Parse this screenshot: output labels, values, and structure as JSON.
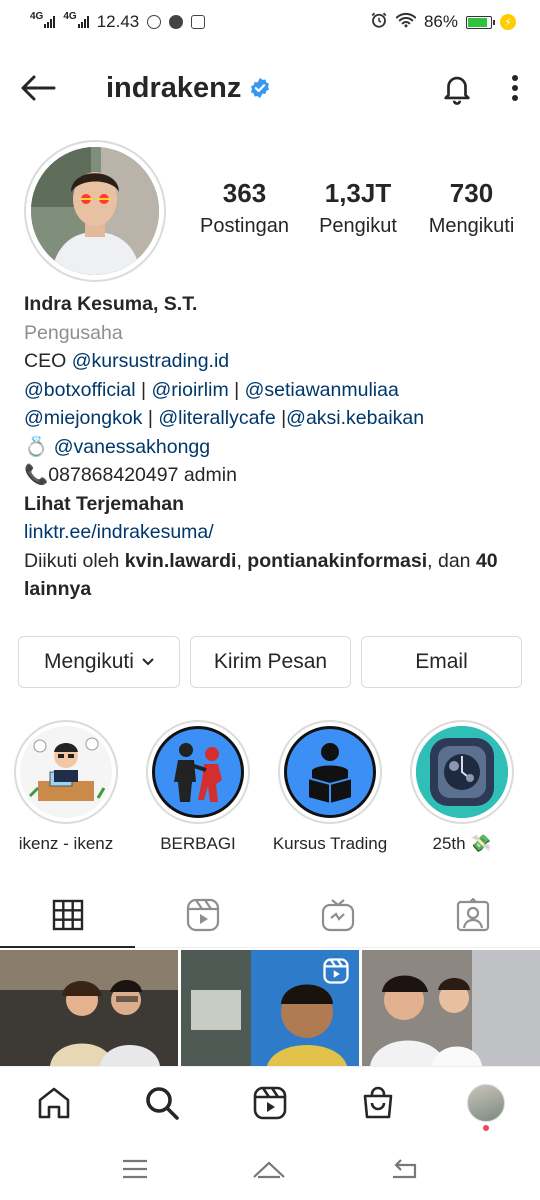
{
  "status_bar": {
    "net1": "4G",
    "net2": "4G",
    "time": "12.43",
    "battery": "86%",
    "battery_level": 0.86
  },
  "header": {
    "username": "indrakenz",
    "icons": [
      "arrow-left-icon",
      "verified-badge-icon",
      "bell-icon",
      "more-vertical-icon"
    ]
  },
  "stats": [
    {
      "num": "363",
      "label": "Postingan"
    },
    {
      "num": "1,3JT",
      "label": "Pengikut"
    },
    {
      "num": "730",
      "label": "Mengikuti"
    }
  ],
  "bio": {
    "name": "Indra Kesuma, S.T.",
    "category": "Pengusaha",
    "line1_prefix": "CEO ",
    "line1_link": "@kursustrading.id",
    "line2": [
      "@botxofficial",
      " | ",
      "@rioirlim",
      " | ",
      "@setiawanmuliaa"
    ],
    "line3": [
      "@miejongkok",
      " | ",
      "@literallycafe",
      " |",
      "@aksi.kebaikan"
    ],
    "ring_emoji": "💍",
    "line4_link": "@vanessakhongg",
    "phone_emoji": "📞",
    "phone": "087868420497 admin",
    "translate": "Lihat Terjemahan",
    "website": "linktr.ee/indrakesuma/",
    "followed_prefix": "Diikuti oleh ",
    "followed_user1": "kvin.lawardi",
    "followed_sep": ", ",
    "followed_user2": "pontianakinformasi",
    "followed_and": ", dan ",
    "followed_rest": "40 lainnya"
  },
  "buttons": {
    "following": "Mengikuti",
    "message": "Kirim Pesan",
    "email": "Email"
  },
  "highlights": [
    {
      "label": "ikenz - ikenz"
    },
    {
      "label": "BERBAGI"
    },
    {
      "label": "Kursus Trading"
    },
    {
      "label": "25th 💸"
    }
  ],
  "tabs": [
    "grid-icon",
    "reels-icon",
    "igtv-icon",
    "tagged-icon"
  ],
  "bottom_nav": [
    "home-icon",
    "search-icon",
    "reels-icon",
    "shop-icon",
    "profile-avatar"
  ],
  "colors": {
    "link": "#00376b",
    "verified": "#3897f0",
    "highlight_blue": "#3b8ff5",
    "notification": "#ed4956"
  }
}
